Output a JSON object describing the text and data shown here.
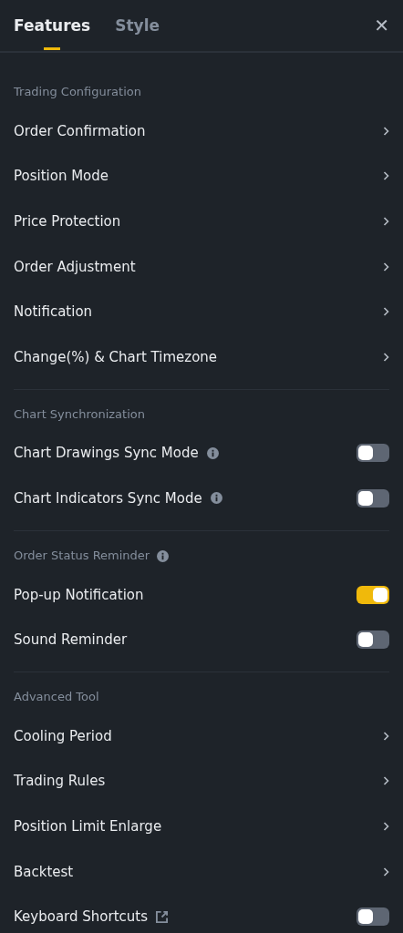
{
  "tabs": [
    {
      "label": "Features",
      "selected": true
    },
    {
      "label": "Style",
      "selected": false
    }
  ],
  "close_button": {
    "label": "✕"
  },
  "sections": [
    {
      "title": "Trading Configuration",
      "info": false,
      "rows": [
        {
          "label": "Order Confirmation",
          "kind": "link"
        },
        {
          "label": "Position Mode",
          "kind": "link"
        },
        {
          "label": "Price Protection",
          "kind": "link"
        },
        {
          "label": "Order Adjustment",
          "kind": "link"
        },
        {
          "label": "Notification",
          "kind": "link"
        },
        {
          "label": "Change(%) & Chart Timezone",
          "kind": "link"
        }
      ]
    },
    {
      "title": "Chart Synchronization",
      "info": false,
      "rows": [
        {
          "label": "Chart Drawings Sync Mode",
          "kind": "toggle",
          "info": true,
          "on": false
        },
        {
          "label": "Chart Indicators Sync Mode",
          "kind": "toggle",
          "info": true,
          "on": false
        }
      ]
    },
    {
      "title": "Order Status Reminder",
      "info": true,
      "rows": [
        {
          "label": "Pop-up Notification",
          "kind": "toggle",
          "on": true
        },
        {
          "label": "Sound Reminder",
          "kind": "toggle",
          "on": false
        }
      ]
    },
    {
      "title": "Advanced Tool",
      "info": false,
      "rows": [
        {
          "label": "Cooling Period",
          "kind": "link"
        },
        {
          "label": "Trading Rules",
          "kind": "link"
        },
        {
          "label": "Position Limit Enlarge",
          "kind": "link"
        },
        {
          "label": "Backtest",
          "kind": "link"
        },
        {
          "label": "Keyboard Shortcuts",
          "kind": "toggle",
          "external": true,
          "on": false
        }
      ]
    }
  ]
}
